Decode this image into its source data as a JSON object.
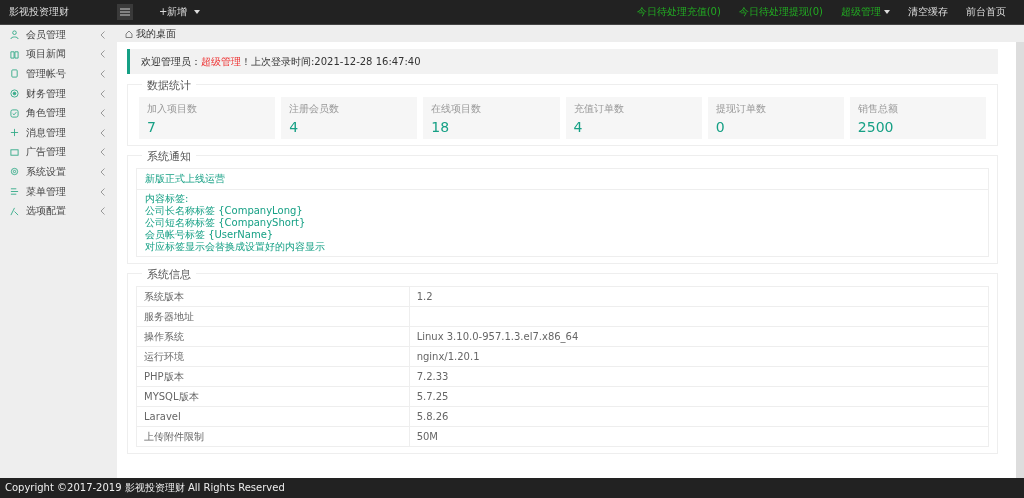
{
  "header": {
    "logo": "影视投资理财",
    "add_menu": "+新增",
    "links": [
      {
        "label": "今日待处理充值(0)",
        "kind": "alert"
      },
      {
        "label": "今日待处理提现(0)",
        "kind": "alert"
      },
      {
        "label": "超级管理",
        "kind": "dropdown"
      },
      {
        "label": "清空缓存",
        "kind": "plain"
      },
      {
        "label": "前台首页",
        "kind": "plain"
      }
    ]
  },
  "sidebar": {
    "items": [
      {
        "label": "会员管理"
      },
      {
        "label": "项目新闻"
      },
      {
        "label": "管理帐号"
      },
      {
        "label": "财务管理"
      },
      {
        "label": "角色管理"
      },
      {
        "label": "消息管理"
      },
      {
        "label": "广告管理"
      },
      {
        "label": "系统设置"
      },
      {
        "label": "菜单管理"
      },
      {
        "label": "选项配置"
      }
    ]
  },
  "breadcrumb": "我的桌面",
  "welcome": {
    "prefix": "欢迎管理员：",
    "role": "超级管理",
    "suffix": "！上次登录时间:2021-12-28 16:47:40"
  },
  "stats": {
    "title": "数据统计",
    "items": [
      {
        "label": "加入项目数",
        "value": "7"
      },
      {
        "label": "注册会员数",
        "value": "4"
      },
      {
        "label": "在线项目数",
        "value": "18"
      },
      {
        "label": "充值订单数",
        "value": "4"
      },
      {
        "label": "提现订单数",
        "value": "0"
      },
      {
        "label": "销售总额",
        "value": "2500"
      }
    ]
  },
  "notice": {
    "title": "系统通知",
    "headline": "新版正式上线运营",
    "lines": [
      "内容标签:",
      "公司长名称标签 {CompanyLong}",
      "公司短名称标签 {CompanyShort}",
      "会员帐号标签 {UserName}",
      "对应标签显示会替换成设置好的内容显示"
    ]
  },
  "info": {
    "title": "系统信息",
    "rows": [
      {
        "label": "系统版本",
        "value": "1.2"
      },
      {
        "label": "服务器地址"
      },
      {
        "label": "操作系统",
        "value": "Linux 3.10.0-957.1.3.el7.x86_64"
      },
      {
        "label": "运行环境",
        "value": "nginx/1.20.1"
      },
      {
        "label": "PHP版本",
        "value": "7.2.33"
      },
      {
        "label": "MYSQL版本",
        "value": "5.7.25"
      },
      {
        "label": "Laravel",
        "value": "5.8.26"
      },
      {
        "label": "上传附件限制",
        "value": "50M"
      }
    ]
  },
  "footer": "Copyright ©2017-2019 影视投资理财 All Rights Reserved"
}
